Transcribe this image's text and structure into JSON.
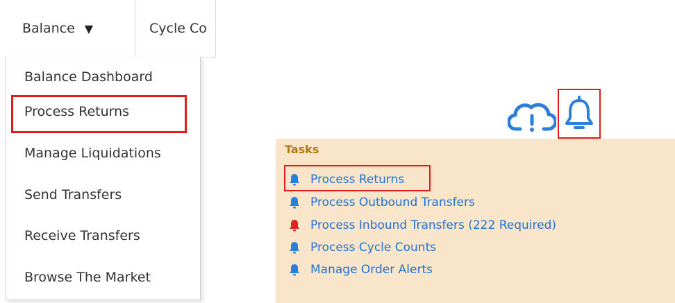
{
  "nav": {
    "balance_label": "Balance",
    "balance_caret": "▼",
    "cycle_label": "Cycle Co"
  },
  "dropdown": {
    "items": [
      {
        "label": "Balance Dashboard"
      },
      {
        "label": "Process Returns"
      },
      {
        "label": "Manage Liquidations"
      },
      {
        "label": "Send Transfers"
      },
      {
        "label": "Receive Transfers"
      },
      {
        "label": "Browse The Market"
      }
    ],
    "highlighted_item": "Process Returns"
  },
  "header_icons": {
    "cloud": "cloud-alert-icon",
    "bell": "bell-icon"
  },
  "tasks": {
    "title": "Tasks",
    "items": [
      {
        "label": "Process Returns",
        "icon": "bell-icon",
        "icon_color": "#2b7fd9"
      },
      {
        "label": "Process Outbound Transfers",
        "icon": "bell-icon",
        "icon_color": "#2b7fd9"
      },
      {
        "label": "Process Inbound Transfers (222 Required)",
        "icon": "bell-icon",
        "icon_color": "#e02424"
      },
      {
        "label": "Process Cycle Counts",
        "icon": "bell-icon",
        "icon_color": "#2b7fd9"
      },
      {
        "label": "Manage Order Alerts",
        "icon": "bell-icon",
        "icon_color": "#2b7fd9"
      }
    ]
  },
  "colors": {
    "link": "#1f72d4",
    "highlight_border": "#e01b1b",
    "panel_bg": "#f9e5c9",
    "tasks_title": "#b07a18"
  }
}
